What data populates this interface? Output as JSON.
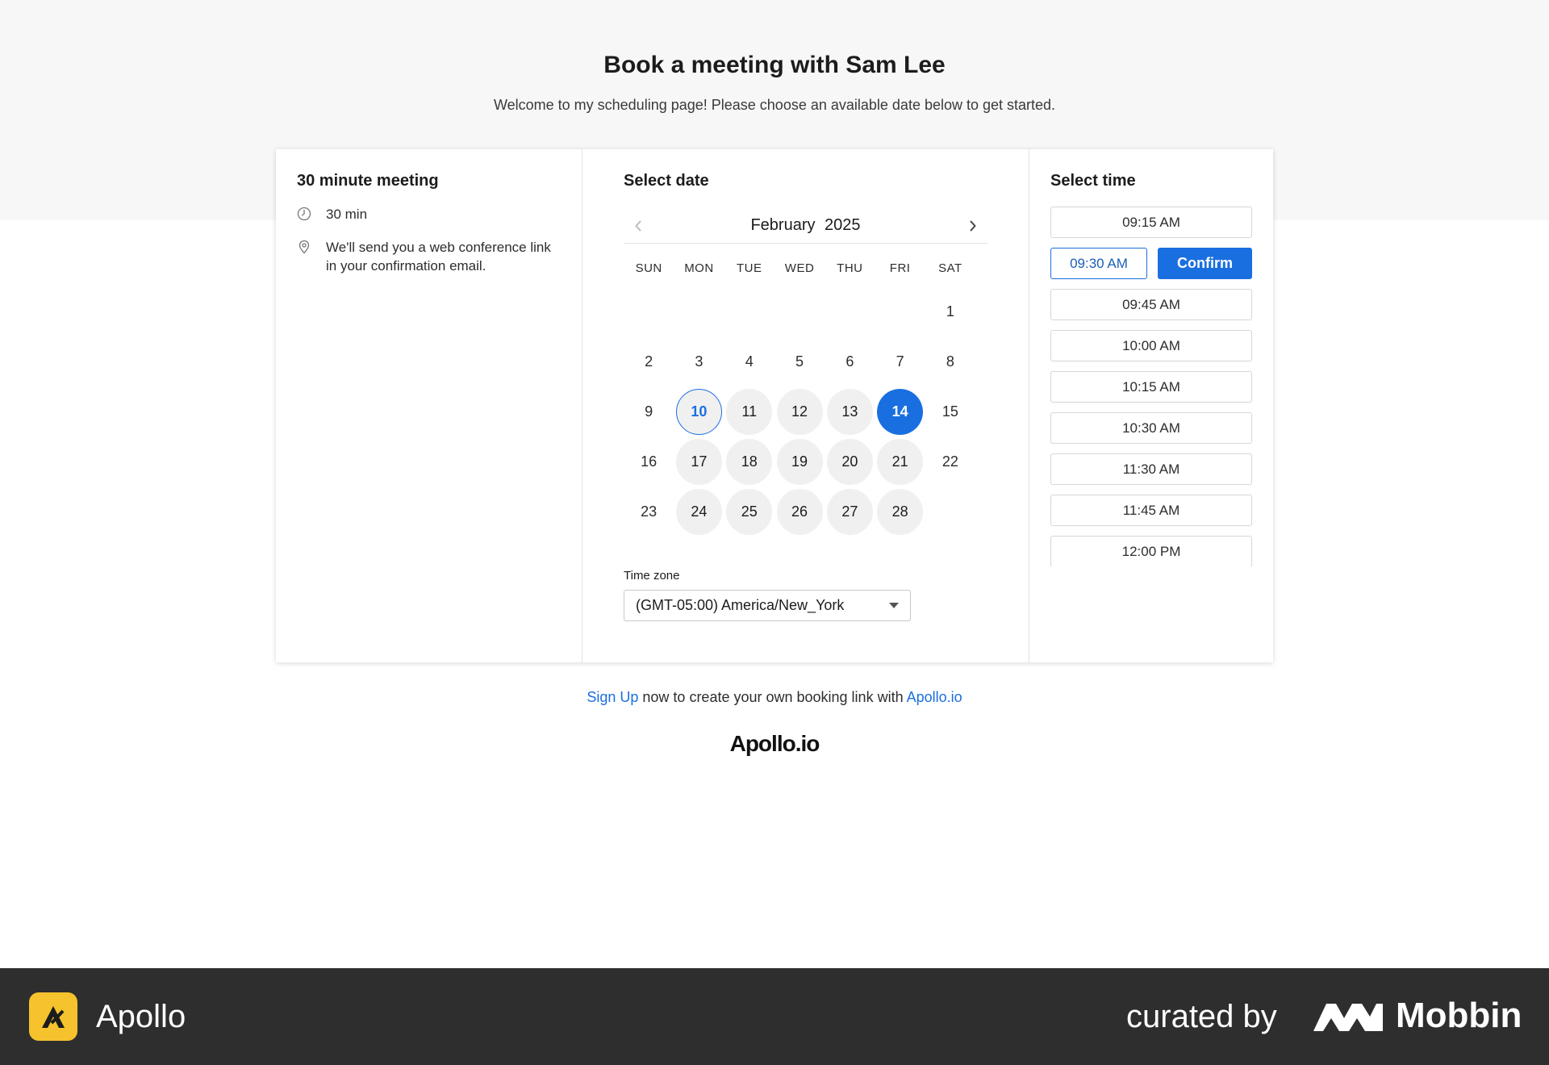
{
  "header": {
    "title": "Book a meeting with Sam Lee",
    "subtitle": "Welcome to my scheduling page! Please choose an available date below to get started."
  },
  "meeting": {
    "heading": "30 minute meeting",
    "duration": "30 min",
    "location_note": "We'll send you a web conference link in your confirmation email."
  },
  "calendar": {
    "heading": "Select date",
    "month": "February",
    "year": "2025",
    "weekdays": [
      "SUN",
      "MON",
      "TUE",
      "WED",
      "THU",
      "FRI",
      "SAT"
    ],
    "leading_blanks": 6,
    "days_in_month": 28,
    "available_days": [
      10,
      11,
      12,
      13,
      14,
      17,
      18,
      19,
      20,
      21,
      24,
      25,
      26,
      27,
      28
    ],
    "today": 10,
    "selected_day": 14
  },
  "timezone": {
    "label": "Time zone",
    "value": "(GMT-05:00) America/New_York"
  },
  "time": {
    "heading": "Select time",
    "slots": [
      "09:15 AM",
      "09:30 AM",
      "09:45 AM",
      "10:00 AM",
      "10:15 AM",
      "10:30 AM",
      "11:30 AM",
      "11:45 AM",
      "12:00 PM"
    ],
    "selected_index": 1,
    "confirm_label": "Confirm"
  },
  "signup": {
    "link_text": "Sign Up",
    "middle_text": " now to create your own booking link with ",
    "brand_link": "Apollo.io"
  },
  "brand_logo": "Apollo.io",
  "footer": {
    "app_name": "Apollo",
    "curated_by": "curated by",
    "mobbin": "Mobbin"
  },
  "colors": {
    "accent": "#1a6fe0",
    "band": "#f7f7f7",
    "footer": "#2e2e2e",
    "apollo_yellow": "#f6c22d"
  },
  "icons": {
    "duration": "clock-icon",
    "location": "map-pin-icon",
    "prev": "chevron-left-icon",
    "next": "chevron-right-icon",
    "dropdown": "caret-down-icon"
  }
}
